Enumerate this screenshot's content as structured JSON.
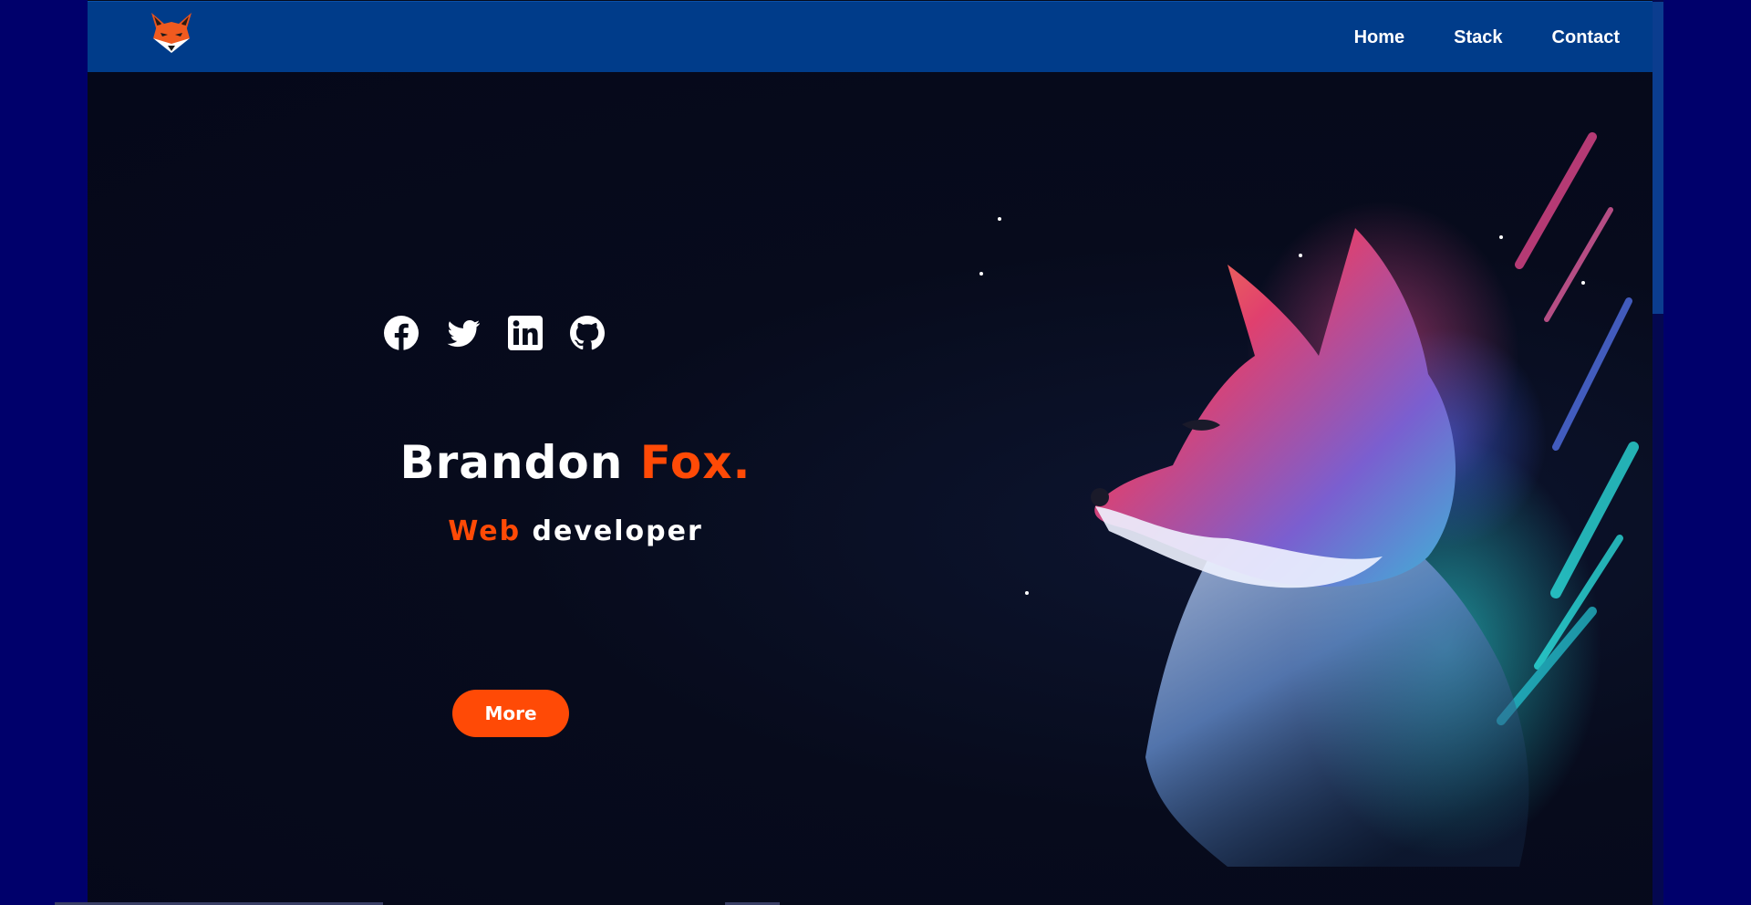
{
  "brand": {
    "logo_icon": "fox-head-logo-icon",
    "colors": {
      "accent": "#ff4a06",
      "navbar": "#003c8a",
      "background": "#060b1a",
      "outer": "#00006b"
    }
  },
  "nav": {
    "items": [
      {
        "label": "Home"
      },
      {
        "label": "Stack"
      },
      {
        "label": "Contact"
      }
    ]
  },
  "socials": [
    {
      "icon": "facebook-icon"
    },
    {
      "icon": "twitter-icon"
    },
    {
      "icon": "linkedin-icon"
    },
    {
      "icon": "github-icon"
    }
  ],
  "hero": {
    "first_name": "Brandon",
    "last_name": "Fox.",
    "role_accent": "Web",
    "role_rest": "developer",
    "button_label": "More",
    "illustration": "neon-fox-illustration"
  }
}
